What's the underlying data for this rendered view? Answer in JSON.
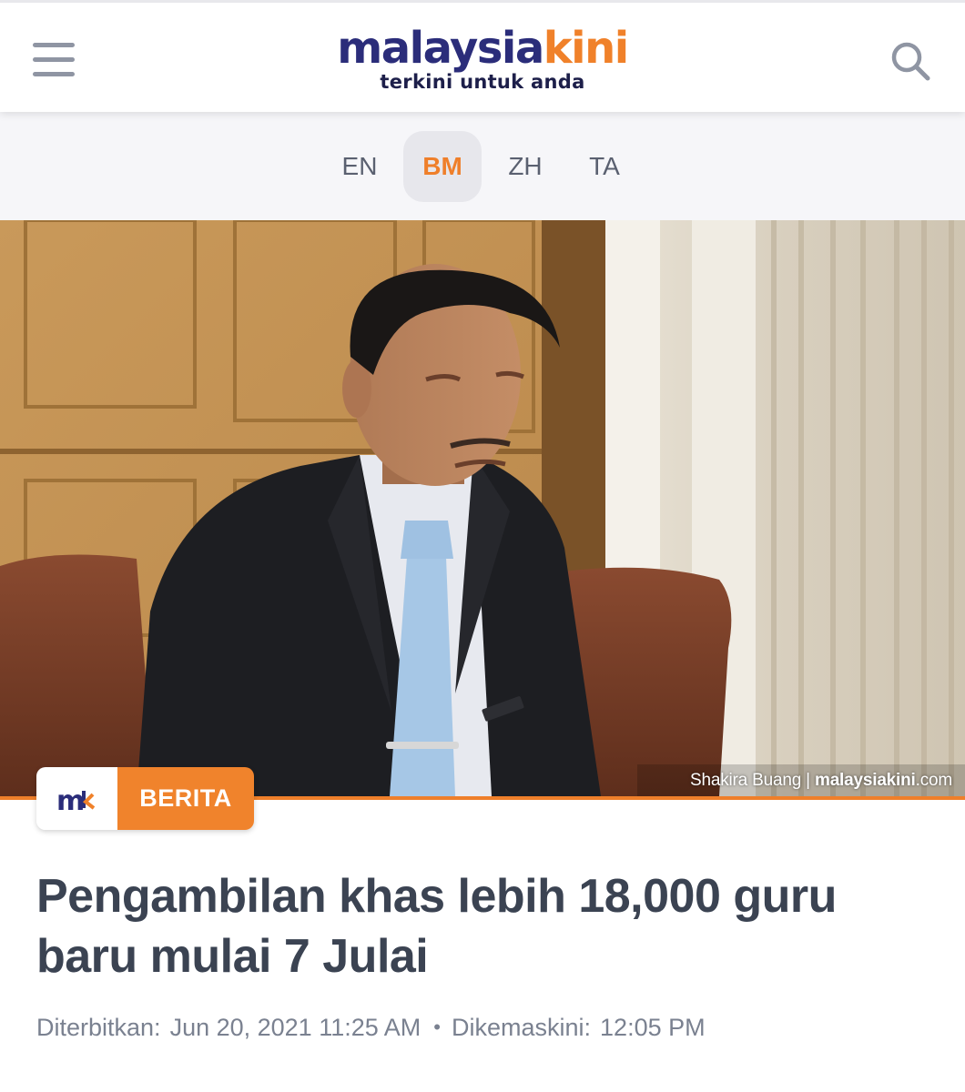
{
  "header": {
    "logo_primary": "malaysia",
    "logo_accent": "kini",
    "tagline": "terkini untuk anda",
    "menu_icon": "hamburger-menu-icon",
    "search_icon": "search-icon"
  },
  "languages": [
    {
      "code": "EN",
      "active": false
    },
    {
      "code": "BM",
      "active": true
    },
    {
      "code": "ZH",
      "active": false
    },
    {
      "code": "TA",
      "active": false
    }
  ],
  "hero": {
    "credit_photographer": "Shakira Buang",
    "credit_separator": "|",
    "credit_site": "malaysiakini",
    "credit_domain": ".com"
  },
  "badge": {
    "logo_text": "mk",
    "label": "BERITA"
  },
  "article": {
    "headline": "Pengambilan khas lebih 18,000 guru baru mulai 7 Julai",
    "published_label": "Diterbitkan:",
    "published_value": "Jun 20, 2021 11:25 AM",
    "separator": "•",
    "updated_label": "Dikemaskini:",
    "updated_value": "12:05 PM"
  },
  "colors": {
    "brand_navy": "#2b2d7a",
    "brand_orange": "#f0812a",
    "text_dark": "#3b4352",
    "text_muted": "#7a8190"
  }
}
